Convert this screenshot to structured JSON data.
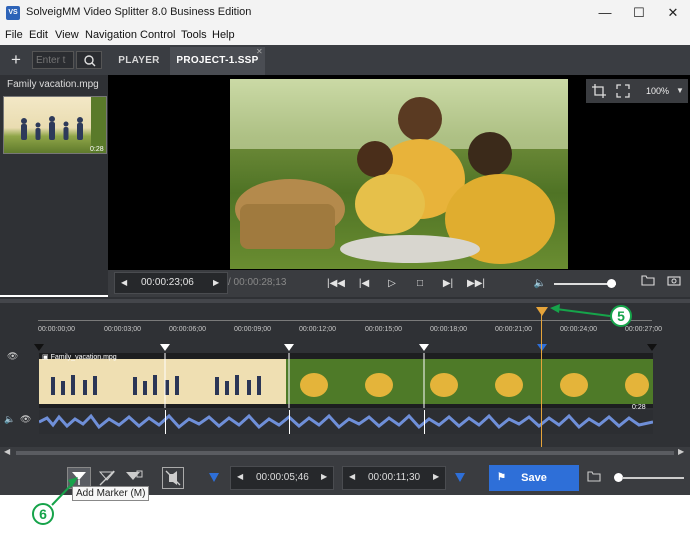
{
  "window": {
    "title": "SolveigMM Video Splitter 8.0 Business Edition",
    "icon_label": "VS"
  },
  "menu": [
    "File",
    "Edit",
    "View",
    "Navigation",
    "Control",
    "Tools",
    "Help"
  ],
  "tabs": {
    "search_placeholder": "Enter t",
    "items": [
      "PLAYER",
      "PROJECT-1.SSP"
    ],
    "active": "PROJECT-1.SSP"
  },
  "media": {
    "file_name": "Family vacation.mpg",
    "thumb_duration": "0:28"
  },
  "preview": {
    "zoom": "100%"
  },
  "transport": {
    "current_time": "00:00:23;06",
    "total_time": "/ 00:00:28;13"
  },
  "timeline": {
    "ticks": [
      "00:00:00;00",
      "00:00:03;00",
      "00:00:06;00",
      "00:00:09;00",
      "00:00:12;00",
      "00:00:15;00",
      "00:00:18;00",
      "00:00:21;00",
      "00:00:24;00",
      "00:00:27;00"
    ],
    "clip_name": "Family_vacation.mpg",
    "clip_duration": "0:28"
  },
  "bottom": {
    "tooltip": "Add Marker (M)",
    "start_time": "00:00:05;46",
    "end_time": "00:00:11;30",
    "save_label": "Save"
  },
  "callouts": [
    "5",
    "6"
  ],
  "colors": {
    "accent": "#2e6fd8",
    "playhead": "#e6a43a",
    "callout": "#16a34a",
    "marker": "#2e6fd8"
  }
}
